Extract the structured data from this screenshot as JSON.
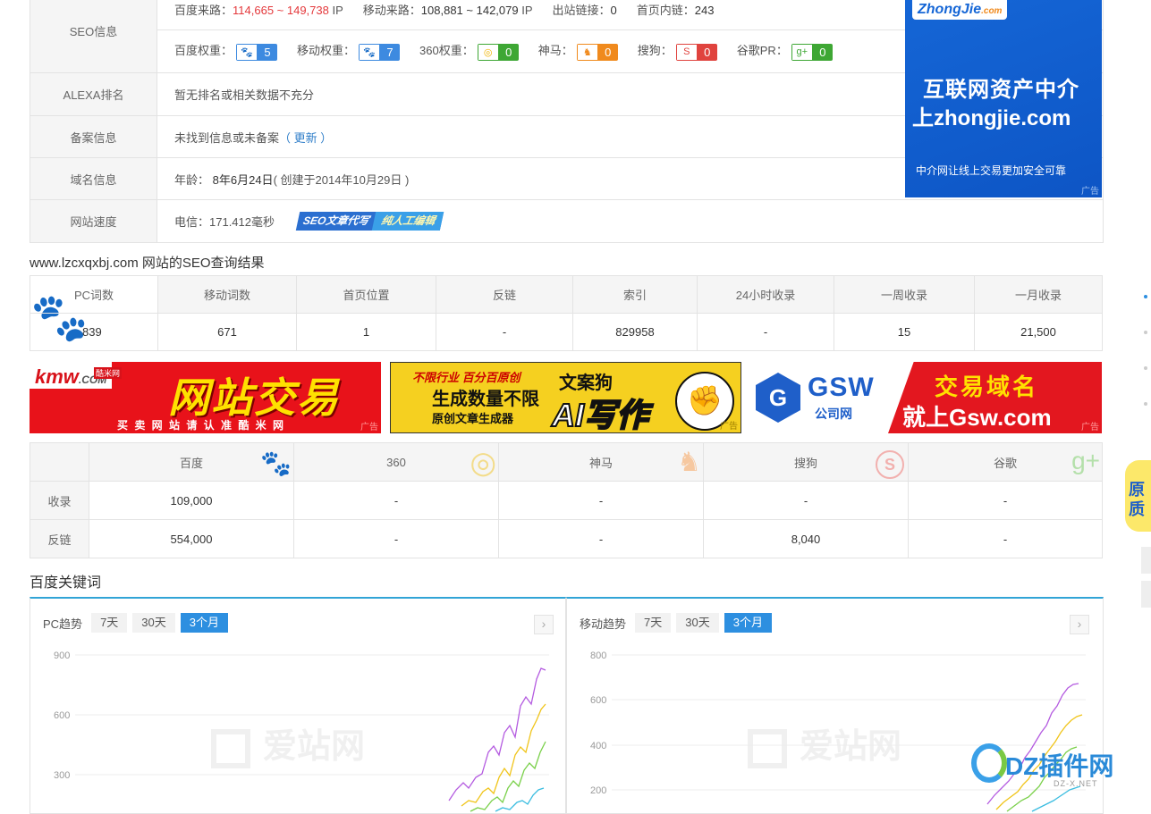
{
  "info": {
    "seo_label": "SEO信息",
    "baidu_traffic_label": "百度来路：",
    "baidu_traffic_value": "114,665 ~ 149,738",
    "ip_unit_1": "IP",
    "mobile_traffic_label": "移动来路：",
    "mobile_traffic_value": "108,881 ~ 142,079",
    "ip_unit_2": "IP",
    "outlinks_label": "出站链接：",
    "outlinks_value": "0",
    "homelinks_label": "首页内链：",
    "homelinks_value": "243",
    "weights": [
      {
        "label": "百度权重：",
        "value": "5",
        "icon": "paw-icon",
        "glyph": "🐾"
      },
      {
        "label": "移动权重：",
        "value": "7",
        "icon": "paw-icon",
        "glyph": "🐾"
      },
      {
        "label": "360权重：",
        "value": "0",
        "icon": "360-icon",
        "glyph": "◎"
      },
      {
        "label": "神马：",
        "value": "0",
        "icon": "shenma-icon",
        "glyph": "♞"
      },
      {
        "label": "搜狗：",
        "value": "0",
        "icon": "sogou-icon",
        "glyph": "S"
      },
      {
        "label": "谷歌PR：",
        "value": "0",
        "icon": "google-plus-icon",
        "glyph": "g+"
      }
    ],
    "alexa_label": "ALEXA排名",
    "alexa_value": "暂无排名或相关数据不充分",
    "beian_label": "备案信息",
    "beian_value": "未找到信息或未备案",
    "beian_update": "（ 更新 ）",
    "domain_label": "域名信息",
    "domain_age_label": "年龄：",
    "domain_age_value": "8年6月24日",
    "domain_created": "( 创建于2014年10月29日 )",
    "speed_label": "网站速度",
    "speed_value": "电信：171.412毫秒",
    "speed_ad_1": "SEO文章代写",
    "speed_ad_2": "纯人工编辑"
  },
  "side_ad": {
    "logo": "ZhongJie",
    "logo_sub": ".com",
    "line1": "互联网资产中介",
    "line2": "上zhongjie.com",
    "line3": "中介网让线上交易更加安全可靠",
    "tag": "广告"
  },
  "seo_result": {
    "title": "www.lzcxqxbj.com 网站的SEO查询结果",
    "headers": [
      "PC词数",
      "移动词数",
      "首页位置",
      "反链",
      "索引",
      "24小时收录",
      "一周收录",
      "一月收录"
    ],
    "values": [
      "839",
      "671",
      "1",
      "-",
      "829958",
      "-",
      "15",
      "21,500"
    ]
  },
  "banners": [
    {
      "brand": "kmw",
      "brand_sub": ".COM",
      "brand_cn": "酷米网",
      "headline": "网站交易",
      "footer": "买 卖 网 站 请 认 准 酷 米 网",
      "tag": "广告"
    },
    {
      "line1": "不限行业 百分百原创",
      "line2": "生成数量不限",
      "line3": "原创文章生成器",
      "brand": "文案狗",
      "headline": "AI写作",
      "tag": "广告"
    },
    {
      "brand": "GSW",
      "brand_cn": "公司网",
      "line1": "交易域名",
      "line2": "就上Gsw.com",
      "tag": "广告"
    }
  ],
  "engines": {
    "headers": [
      "",
      "百度",
      "360",
      "神马",
      "搜狗",
      "谷歌"
    ],
    "rows": [
      {
        "label": "收录",
        "values": [
          "109,000",
          "-",
          "-",
          "-",
          "-"
        ]
      },
      {
        "label": "反链",
        "values": [
          "554,000",
          "-",
          "-",
          "8,040",
          "-"
        ]
      }
    ]
  },
  "keywords": {
    "title": "百度关键词",
    "pc": {
      "title": "PC趋势",
      "tabs": [
        "7天",
        "30天",
        "3个月"
      ],
      "active": 2,
      "yticks": [
        "900",
        "600",
        "300"
      ],
      "watermark": "爱站网",
      "next": "›"
    },
    "mobile": {
      "title": "移动趋势",
      "tabs": [
        "7天",
        "30天",
        "3个月"
      ],
      "active": 2,
      "yticks": [
        "800",
        "600",
        "400",
        "200"
      ],
      "watermark": "爱站网",
      "next": "›"
    }
  },
  "dz_logo": {
    "text": "DZ插件网",
    "sub": "DZ-X.NET"
  },
  "colors": {
    "accent": "#2d8fe0",
    "red": "#e4393c",
    "line_purple": "#b45be0",
    "line_yellow": "#f0c419",
    "line_green": "#7ad04a",
    "line_blue": "#3bbde0"
  }
}
